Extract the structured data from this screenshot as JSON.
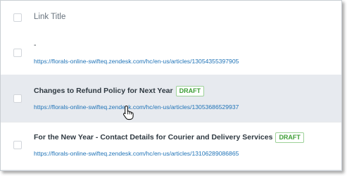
{
  "table": {
    "header": {
      "column_title": "Link Title"
    },
    "rows": [
      {
        "title": "-",
        "url": "https://florals-online-swifteq.zendesk.com/hc/en-us/articles/13054355397905"
      },
      {
        "title": "Changes to Refund Policy for Next Year",
        "badge": "DRAFT",
        "url": "https://florals-online-swifteq.zendesk.com/hc/en-us/articles/13053686529937"
      },
      {
        "title": "For the New Year - Contact Details for Courier and Delivery Services",
        "badge": "DRAFT",
        "url": "https://florals-online-swifteq.zendesk.com/hc/en-us/articles/13106289086865"
      }
    ]
  },
  "cursor": {
    "icon": "hand-pointer-icon"
  },
  "colors": {
    "link": "#1f73b7",
    "badge_text": "#3d9e35",
    "badge_border": "#9dd198",
    "hover_row": "#e7eaef"
  }
}
